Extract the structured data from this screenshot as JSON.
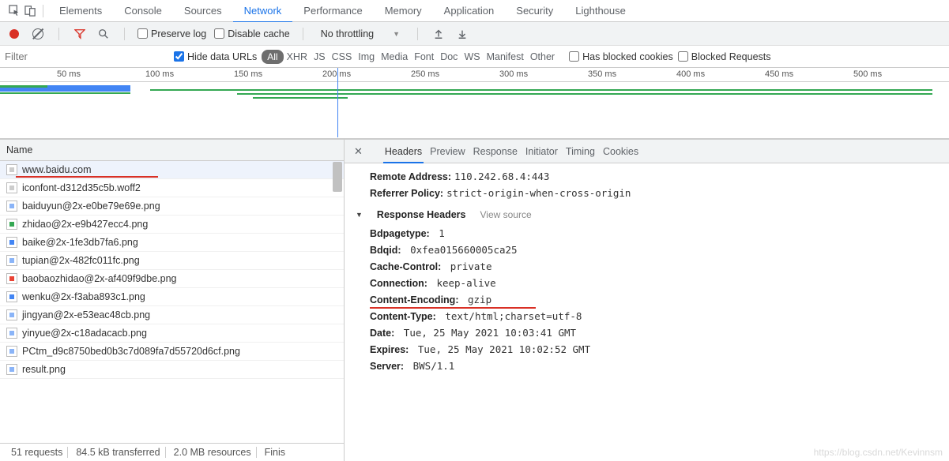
{
  "tabs": [
    "Elements",
    "Console",
    "Sources",
    "Network",
    "Performance",
    "Memory",
    "Application",
    "Security",
    "Lighthouse"
  ],
  "activeTab": "Network",
  "toolbar": {
    "preserve": "Preserve log",
    "disable": "Disable cache",
    "throttle": "No throttling"
  },
  "filter": {
    "placeholder": "Filter",
    "hideData": "Hide data URLs",
    "types": [
      "All",
      "XHR",
      "JS",
      "CSS",
      "Img",
      "Media",
      "Font",
      "Doc",
      "WS",
      "Manifest",
      "Other"
    ],
    "blocked": "Has blocked cookies",
    "blockedReq": "Blocked Requests"
  },
  "timeline": {
    "ticks": [
      "50 ms",
      "100 ms",
      "150 ms",
      "200 ms",
      "250 ms",
      "300 ms",
      "350 ms",
      "400 ms",
      "450 ms",
      "500 ms"
    ]
  },
  "list": {
    "header": "Name",
    "items": [
      {
        "name": "www.baidu.com",
        "icon": "doc",
        "underline": true
      },
      {
        "name": "iconfont-d312d35c5b.woff2",
        "icon": "doc"
      },
      {
        "name": "baiduyun@2x-e0be79e69e.png",
        "icon": "img"
      },
      {
        "name": "zhidao@2x-e9b427ecc4.png",
        "icon": "img-g"
      },
      {
        "name": "baike@2x-1fe3db7fa6.png",
        "icon": "img-b"
      },
      {
        "name": "tupian@2x-482fc011fc.png",
        "icon": "img"
      },
      {
        "name": "baobaozhidao@2x-af409f9dbe.png",
        "icon": "img-r"
      },
      {
        "name": "wenku@2x-f3aba893c1.png",
        "icon": "img-b"
      },
      {
        "name": "jingyan@2x-e53eac48cb.png",
        "icon": "img"
      },
      {
        "name": "yinyue@2x-c18adacacb.png",
        "icon": "img"
      },
      {
        "name": "PCtm_d9c8750bed0b3c7d089fa7d55720d6cf.png",
        "icon": "img"
      },
      {
        "name": "result.png",
        "icon": "img"
      }
    ]
  },
  "status": {
    "requests": "51 requests",
    "transferred": "84.5 kB transferred",
    "resources": "2.0 MB resources",
    "finish": "Finis"
  },
  "rtabs": [
    "Headers",
    "Preview",
    "Response",
    "Initiator",
    "Timing",
    "Cookies"
  ],
  "activeRtab": "Headers",
  "general": {
    "remoteAddrLabel": "Remote Address:",
    "remoteAddr": "110.242.68.4:443",
    "refPolicyLabel": "Referrer Policy:",
    "refPolicy": "strict-origin-when-cross-origin"
  },
  "respSection": {
    "title": "Response Headers",
    "viewSource": "View source"
  },
  "resp": [
    {
      "k": "Bdpagetype:",
      "v": "1"
    },
    {
      "k": "Bdqid:",
      "v": "0xfea015660005ca25"
    },
    {
      "k": "Cache-Control:",
      "v": "private"
    },
    {
      "k": "Connection:",
      "v": "keep-alive"
    },
    {
      "k": "Content-Encoding:",
      "v": "gzip",
      "underline": true
    },
    {
      "k": "Content-Type:",
      "v": "text/html;charset=utf-8"
    },
    {
      "k": "Date:",
      "v": "Tue, 25 May 2021 10:03:41 GMT"
    },
    {
      "k": "Expires:",
      "v": "Tue, 25 May 2021 10:02:52 GMT"
    },
    {
      "k": "Server:",
      "v": "BWS/1.1"
    }
  ],
  "watermark": "https://blog.csdn.net/Kevinnsm"
}
